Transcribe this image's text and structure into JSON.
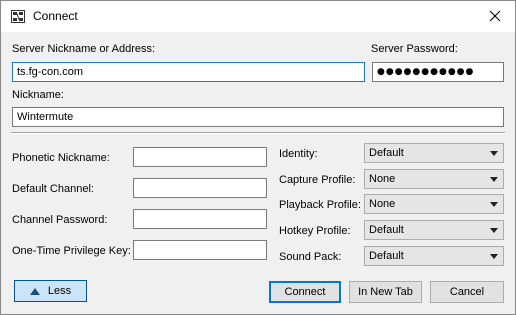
{
  "window": {
    "title": "Connect",
    "close_symbol": "✕"
  },
  "server": {
    "address_label": "Server Nickname or Address:",
    "address_value": "ts.fg-con.com",
    "password_label": "Server Password:",
    "password_value": "●●●●●●●●●●●"
  },
  "nickname": {
    "label": "Nickname:",
    "value": "Wintermute"
  },
  "advanced": {
    "phonetic_label": "Phonetic Nickname:",
    "phonetic_value": "",
    "default_channel_label": "Default Channel:",
    "default_channel_value": "",
    "channel_password_label": "Channel Password:",
    "channel_password_value": "",
    "privilege_key_label": "One-Time Privilege Key:",
    "privilege_key_value": ""
  },
  "profiles": {
    "identity_label": "Identity:",
    "identity_value": "Default",
    "capture_label": "Capture Profile:",
    "capture_value": "None",
    "playback_label": "Playback Profile:",
    "playback_value": "None",
    "hotkey_label": "Hotkey Profile:",
    "hotkey_value": "Default",
    "soundpack_label": "Sound Pack:",
    "soundpack_value": "Default"
  },
  "buttons": {
    "less": "Less",
    "connect": "Connect",
    "new_tab": "In New Tab",
    "cancel": "Cancel"
  },
  "icons": {
    "app": "connect-icon",
    "close": "close-icon",
    "less": "triangle-up-icon",
    "dropdown": "chevron-down-icon"
  },
  "colors": {
    "focus_border": "#1979ca",
    "default_button_border": "#0078d7",
    "less_button_bg": "#cce4f7",
    "window_bg": "#f0f0f0"
  }
}
